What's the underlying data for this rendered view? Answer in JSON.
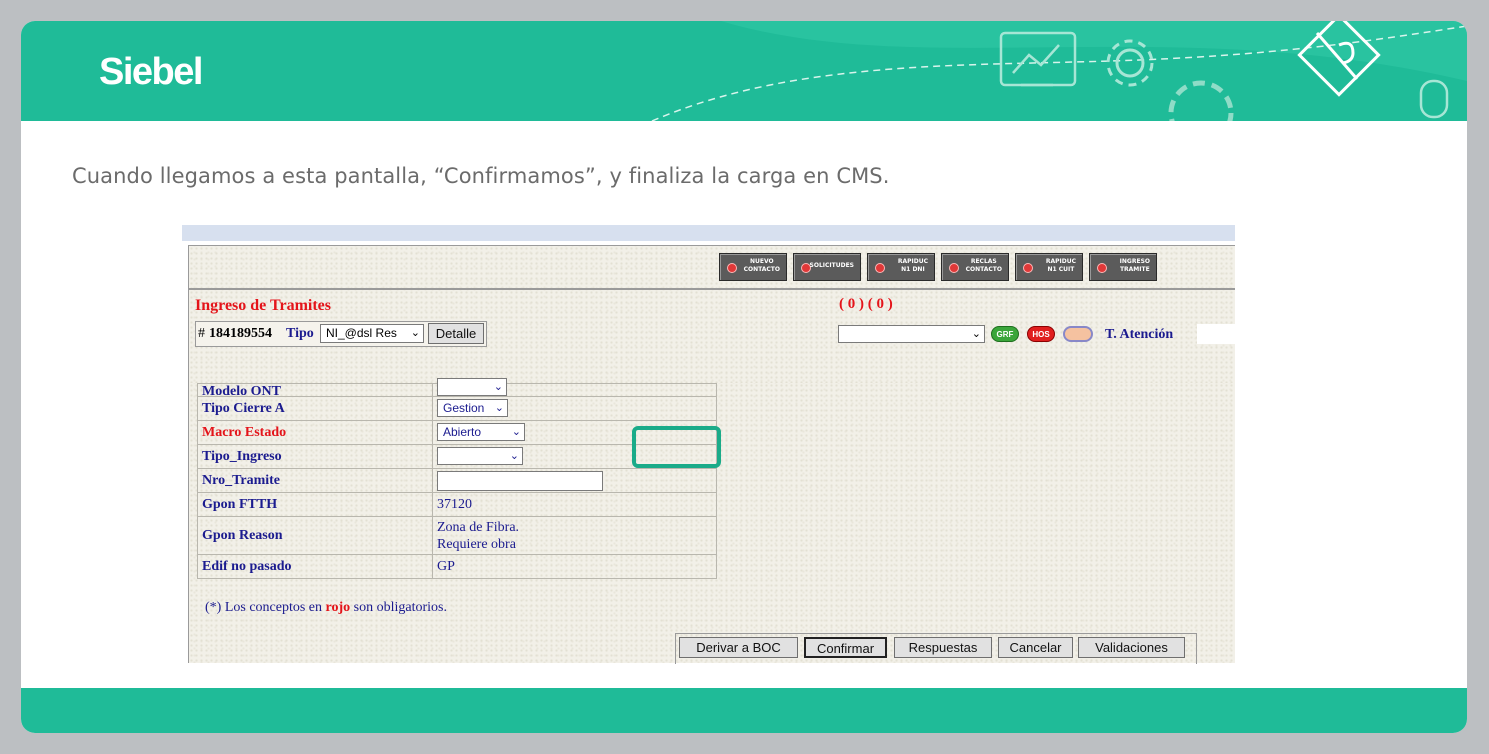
{
  "slide": {
    "brand": "Siebel",
    "caption": "Cuando llegamos a esta pantalla, “Confirmamos”, y finaliza la carga en CMS.",
    "colors": {
      "header": "#1fbb98",
      "highlight": "#1aab89",
      "background": "#bcbfc2"
    }
  },
  "app": {
    "toolbar": [
      {
        "label": "NUEVO\nCONTACTO"
      },
      {
        "label": "SOLICITUDES"
      },
      {
        "label": "RAPIDUC\nN1 DNI"
      },
      {
        "label": "RECLAS\nCONTACTO"
      },
      {
        "label": "RAPIDUC\nN1 CUIT"
      },
      {
        "label": "INGRESO\nTRAMITE"
      }
    ],
    "title": "Ingreso de Tramites",
    "counts": "( 0 ) ( 0 )",
    "hash": "#",
    "id_number": "184189554",
    "tipo_label": "Tipo",
    "tipo_value": "NI_@dsl Res",
    "detalle_button": "Detalle",
    "status_pills": [
      "GRF",
      "HOS",
      ""
    ],
    "t_atencion": "T. Atención",
    "fields": [
      {
        "label": "Modelo ONT",
        "value": ""
      },
      {
        "label": "Tipo Cierre A",
        "value": "Gestion"
      },
      {
        "label": "Macro Estado",
        "value": "Abierto"
      },
      {
        "label": "Tipo_Ingreso",
        "value": ""
      },
      {
        "label": "Nro_Tramite",
        "value": ""
      },
      {
        "label": "Gpon FTTH",
        "value": "37120"
      },
      {
        "label": "Gpon Reason",
        "value": "Zona de Fibra.",
        "value2": "Requiere obra"
      },
      {
        "label": "Edif no pasado",
        "value": "GP"
      }
    ],
    "note_prefix": "(*) Los conceptos en ",
    "note_red": "rojo",
    "note_suffix": " son obligatorios.",
    "buttons": {
      "derivar": "Derivar a BOC",
      "confirmar": "Confirmar",
      "respuestas": "Respuestas",
      "cancelar": "Cancelar",
      "validaciones": "Validaciones"
    }
  }
}
